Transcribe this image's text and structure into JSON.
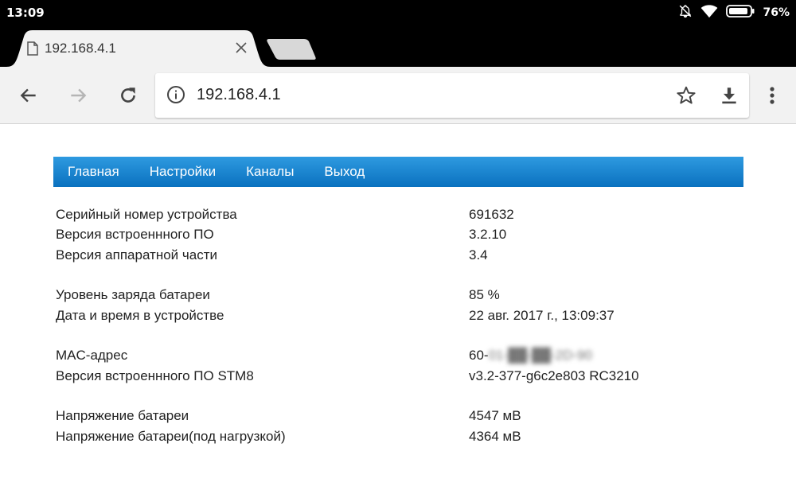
{
  "status_bar": {
    "time": "13:09",
    "battery_percent": "76%"
  },
  "tab": {
    "title": "192.168.4.1"
  },
  "omnibox": {
    "url": "192.168.4.1"
  },
  "nav": {
    "items": [
      "Главная",
      "Настройки",
      "Каналы",
      "Выход"
    ]
  },
  "info": {
    "groups": [
      [
        {
          "label": "Серийный номер устройства",
          "value": "691632"
        },
        {
          "label": "Версия встроеннного ПО",
          "value": "3.2.10"
        },
        {
          "label": "Версия аппаратной части",
          "value": "3.4"
        }
      ],
      [
        {
          "label": "Уровень заряда батареи",
          "value": "85 %"
        },
        {
          "label": "Дата и время в устройстве",
          "value": "22 авг. 2017 г., 13:09:37"
        }
      ],
      [
        {
          "label": "MAC-адрес",
          "value": "60-",
          "value_obscured": "01-██-██-2D-90"
        },
        {
          "label": "Версия встроеннного ПО STM8",
          "value": "v3.2-377-g6c2e803 RC3210"
        }
      ],
      [
        {
          "label": "Напряжение батареи",
          "value": "4547 мВ"
        },
        {
          "label": "Напряжение батареи(под нагрузкой)",
          "value": "4364 мВ"
        }
      ]
    ]
  },
  "colors": {
    "nav_top": "#2e9ae0",
    "nav_bottom": "#0a71bf",
    "toolbar_bg": "#f2f2f2",
    "chrome_bg": "#000000"
  }
}
